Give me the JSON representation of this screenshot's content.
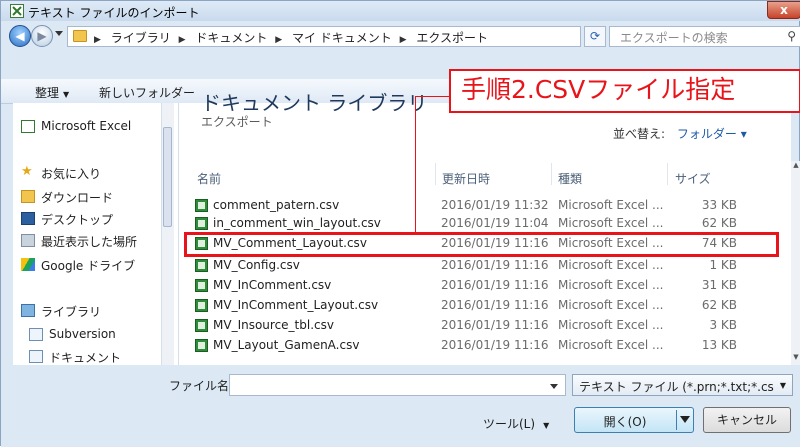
{
  "window": {
    "title": "テキスト ファイルのインポート",
    "close_label": "x"
  },
  "address_bar": {
    "crumbs": [
      "ライブラリ",
      "ドキュメント",
      "マイ ドキュメント",
      "エクスポート"
    ],
    "search_placeholder": "エクスポートの検索"
  },
  "toolbar": {
    "organize_label": "整理",
    "new_folder_label": "新しいフォルダー"
  },
  "sidebar": {
    "items": [
      {
        "label": "Microsoft Excel",
        "icon": "excel-icon"
      },
      {
        "label": "お気に入り",
        "icon": "star-icon"
      },
      {
        "label": "ダウンロード",
        "icon": "download-folder-icon"
      },
      {
        "label": "デスクトップ",
        "icon": "desktop-icon"
      },
      {
        "label": "最近表示した場所",
        "icon": "recent-places-icon"
      },
      {
        "label": "Google ドライブ",
        "icon": "google-drive-icon"
      },
      {
        "label": "ライブラリ",
        "icon": "library-icon"
      },
      {
        "label": "Subversion",
        "icon": "document-library-icon"
      },
      {
        "label": "ドキュメント",
        "icon": "document-library-icon"
      }
    ]
  },
  "library": {
    "title": "ドキュメント ライブラリ",
    "subtitle": "エクスポート",
    "arrange_label": "並べ替え:",
    "arrange_value": "フォルダー"
  },
  "columns": {
    "name": "名前",
    "date": "更新日時",
    "type": "種類",
    "size": "サイズ"
  },
  "files": [
    {
      "name": "comment_patern.csv",
      "date": "2016/01/19 11:32",
      "type": "Microsoft Excel ...",
      "size": "33 KB"
    },
    {
      "name": "in_comment_win_layout.csv",
      "date": "2016/01/19 11:04",
      "type": "Microsoft Excel ...",
      "size": "62 KB"
    },
    {
      "name": "MV_Comment_Layout.csv",
      "date": "2016/01/19 11:16",
      "type": "Microsoft Excel ...",
      "size": "74 KB"
    },
    {
      "name": "MV_Config.csv",
      "date": "2016/01/19 11:16",
      "type": "Microsoft Excel ...",
      "size": "1 KB"
    },
    {
      "name": "MV_InComment.csv",
      "date": "2016/01/19 11:16",
      "type": "Microsoft Excel ...",
      "size": "31 KB"
    },
    {
      "name": "MV_InComment_Layout.csv",
      "date": "2016/01/19 11:16",
      "type": "Microsoft Excel ...",
      "size": "62 KB"
    },
    {
      "name": "MV_Insource_tbl.csv",
      "date": "2016/01/19 11:16",
      "type": "Microsoft Excel ...",
      "size": "3 KB"
    },
    {
      "name": "MV_Layout_GamenA.csv",
      "date": "2016/01/19 11:16",
      "type": "Microsoft Excel ...",
      "size": "13 KB"
    }
  ],
  "annotation": {
    "text": "手順2.CSVファイル指定",
    "color": "#e8141a"
  },
  "bottom": {
    "filename_label": "ファイル名(N):",
    "filename_value": "",
    "filetype_value": "テキスト ファイル (*.prn;*.txt;*.cs",
    "tools_label": "ツール(L)",
    "open_label": "開く(O)",
    "cancel_label": "キャンセル"
  }
}
